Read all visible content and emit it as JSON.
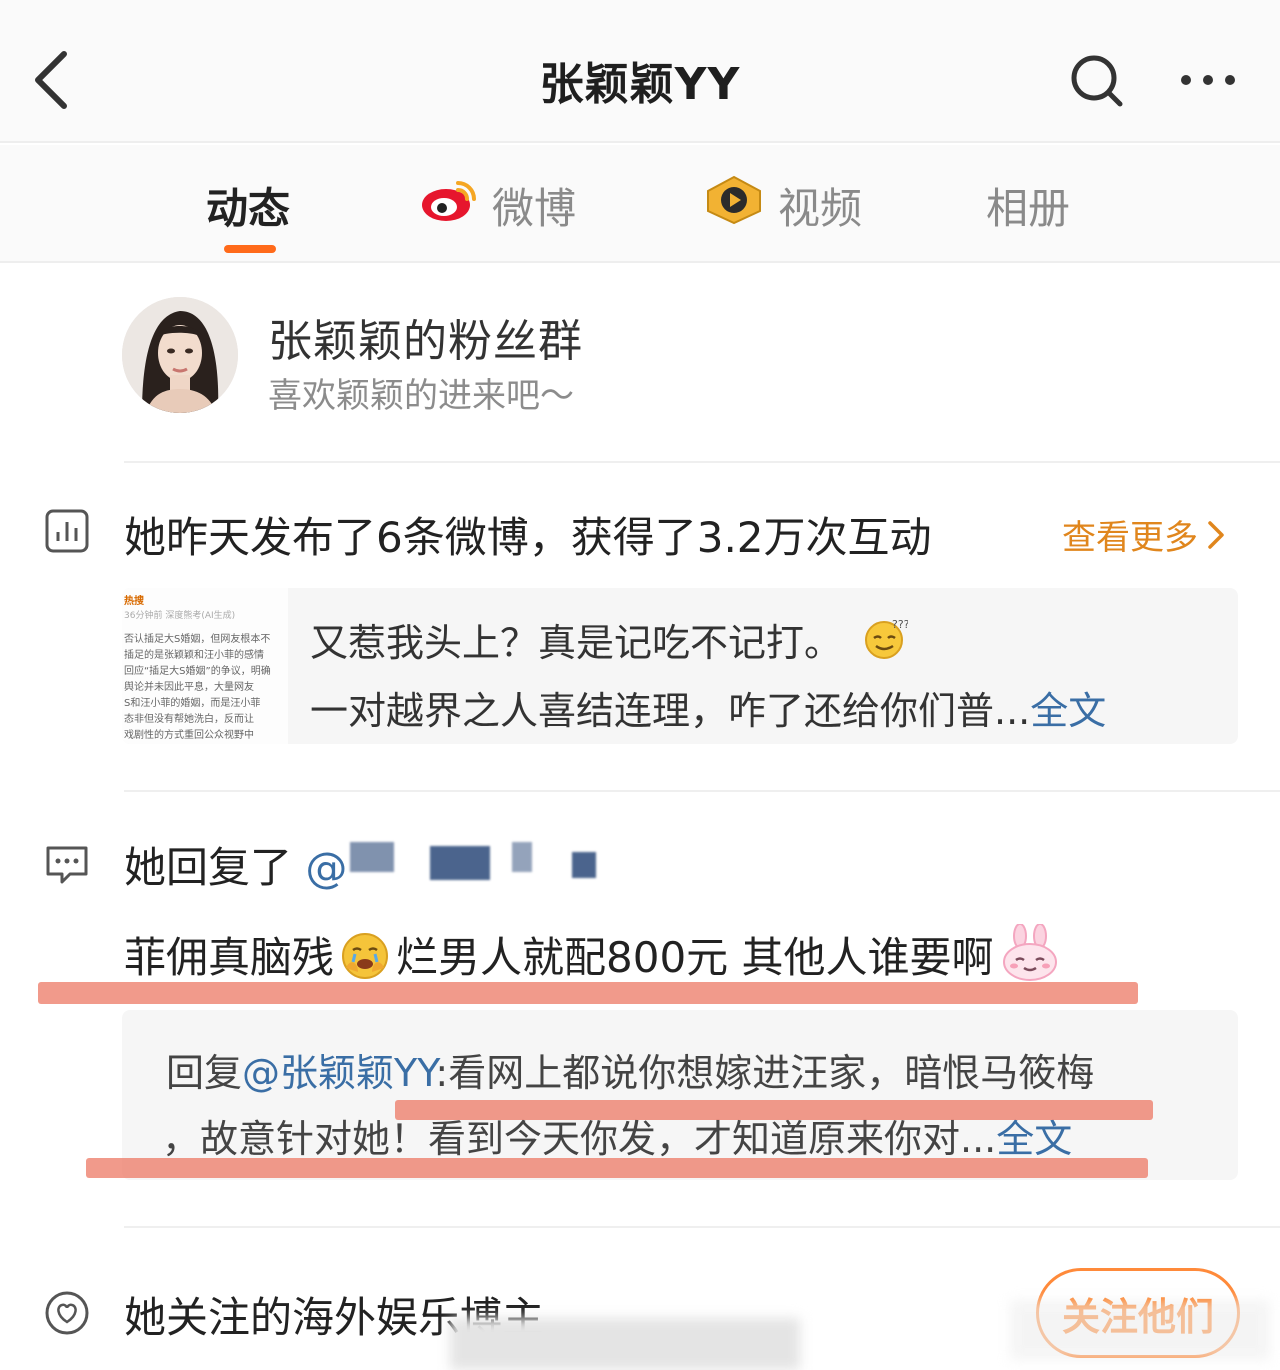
{
  "header": {
    "title": "张颖颖YY"
  },
  "tabs": [
    {
      "label": "动态",
      "active": true
    },
    {
      "label": "微博",
      "icon": "weibo-icon"
    },
    {
      "label": "视频",
      "icon": "video-icon"
    },
    {
      "label": "相册"
    }
  ],
  "fans_group": {
    "name": "张颖颖的粉丝群",
    "subtitle": "喜欢颖颖的进来吧～"
  },
  "stats": {
    "text": "她昨天发布了6条微博，获得了3.2万次互动",
    "more_label": "查看更多"
  },
  "post_card": {
    "line1": "又惹我头上？真是记吃不记打。",
    "line2": "一对越界之人喜结连理，咋了还给你们普...",
    "full_text": "全文",
    "thumb_lines": [
      "热搜",
      "36分钟前 深度熊考(AI生成)",
      "否认插足大S婚姻，但网友根本不",
      "插足的是张颖颖和汪小菲的感情",
      "回应“插足大S婚姻”的争议，明确",
      "舆论并未因此平息，大量网友",
      "S和汪小菲的婚姻，而是汪小菲",
      "态非但没有帮她洗白，反而让",
      "戏剧性的方式重回公众视野中"
    ]
  },
  "reply": {
    "head": "她回复了",
    "at": "@",
    "body_part1": "菲佣真脑残",
    "body_part2": "烂男人就配800元 其他人谁要啊",
    "quote_prefix": "回复",
    "quote_mention": "@张颖颖YY",
    "quote_rest": ":看网上都说你想嫁进汪家，暗恨马筱梅",
    "quote_line2": "，故意针对她！看到今天你发，才知道原来你对...",
    "full_text": "全文"
  },
  "follow": {
    "text": "她关注的海外娱乐博主",
    "button_label": "关注他们"
  },
  "colors": {
    "accent": "#ff6a1a",
    "link": "#3a6ea5",
    "more": "#e0861d",
    "highlight": "#ec7864"
  }
}
